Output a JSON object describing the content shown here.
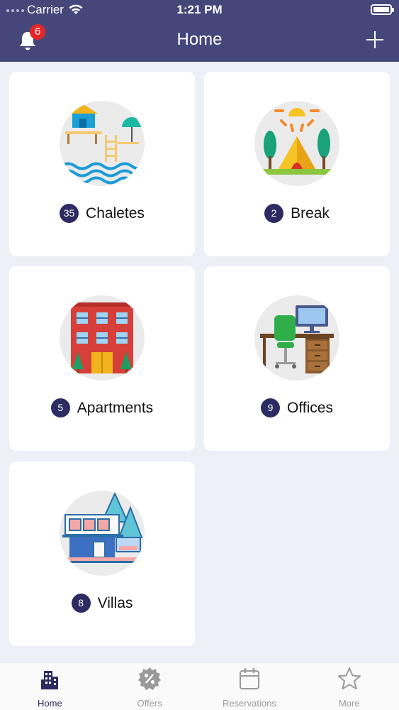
{
  "status_bar": {
    "carrier": "Carrier",
    "time": "1:21 PM"
  },
  "header": {
    "title": "Home",
    "notification_count": "6"
  },
  "categories": [
    {
      "count": "35",
      "name": "Chaletes",
      "icon": "beach-house-icon"
    },
    {
      "count": "2",
      "name": "Break",
      "icon": "camping-tent-icon"
    },
    {
      "count": "5",
      "name": "Apartments",
      "icon": "apartment-building-icon"
    },
    {
      "count": "9",
      "name": "Offices",
      "icon": "office-desk-icon"
    },
    {
      "count": "8",
      "name": "Villas",
      "icon": "villa-house-icon"
    }
  ],
  "tabbar": {
    "items": [
      {
        "label": "Home",
        "icon": "building-icon",
        "active": true
      },
      {
        "label": "Offers",
        "icon": "percent-badge-icon",
        "active": false
      },
      {
        "label": "Reservations",
        "icon": "calendar-icon",
        "active": false
      },
      {
        "label": "More",
        "icon": "star-icon",
        "active": false
      }
    ]
  },
  "colors": {
    "header_bg": "#45477a",
    "accent": "#2d2b62",
    "badge": "#e52526",
    "page_bg": "#eef0f8"
  }
}
